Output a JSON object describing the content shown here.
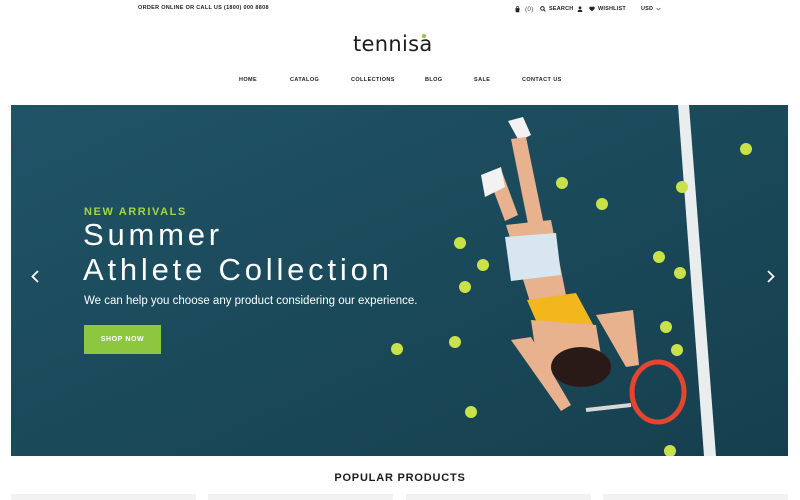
{
  "topbar": {
    "promo": "ORDER ONLINE OR CALL US (1800) 000 8808",
    "cart_count": "(0)",
    "search_label": "SEARCH",
    "wishlist_label": "WISHLIST",
    "currency": "USD"
  },
  "brand": {
    "name": "tennisa",
    "accent_color": "#8dc63f"
  },
  "nav": {
    "items": [
      {
        "label": "HOME"
      },
      {
        "label": "CATALOG"
      },
      {
        "label": "COLLECTIONS"
      },
      {
        "label": "BLOG"
      },
      {
        "label": "SALE"
      },
      {
        "label": "CONTACT US"
      }
    ]
  },
  "hero": {
    "eyebrow": "NEW ARRIVALS",
    "title_line1": "Summer",
    "title_line2": "Athlete Collection",
    "subtitle": "We can help you choose any product considering our experience.",
    "cta_label": "SHOP NOW",
    "background_color": "#1b4d5e",
    "eyebrow_color": "#a6d63f"
  },
  "products": {
    "section_title": "POPULAR PRODUCTS"
  },
  "icons": [
    "cart-icon",
    "search-icon",
    "user-icon",
    "heart-icon",
    "chevron-down-icon",
    "chevron-left-icon",
    "chevron-right-icon"
  ]
}
